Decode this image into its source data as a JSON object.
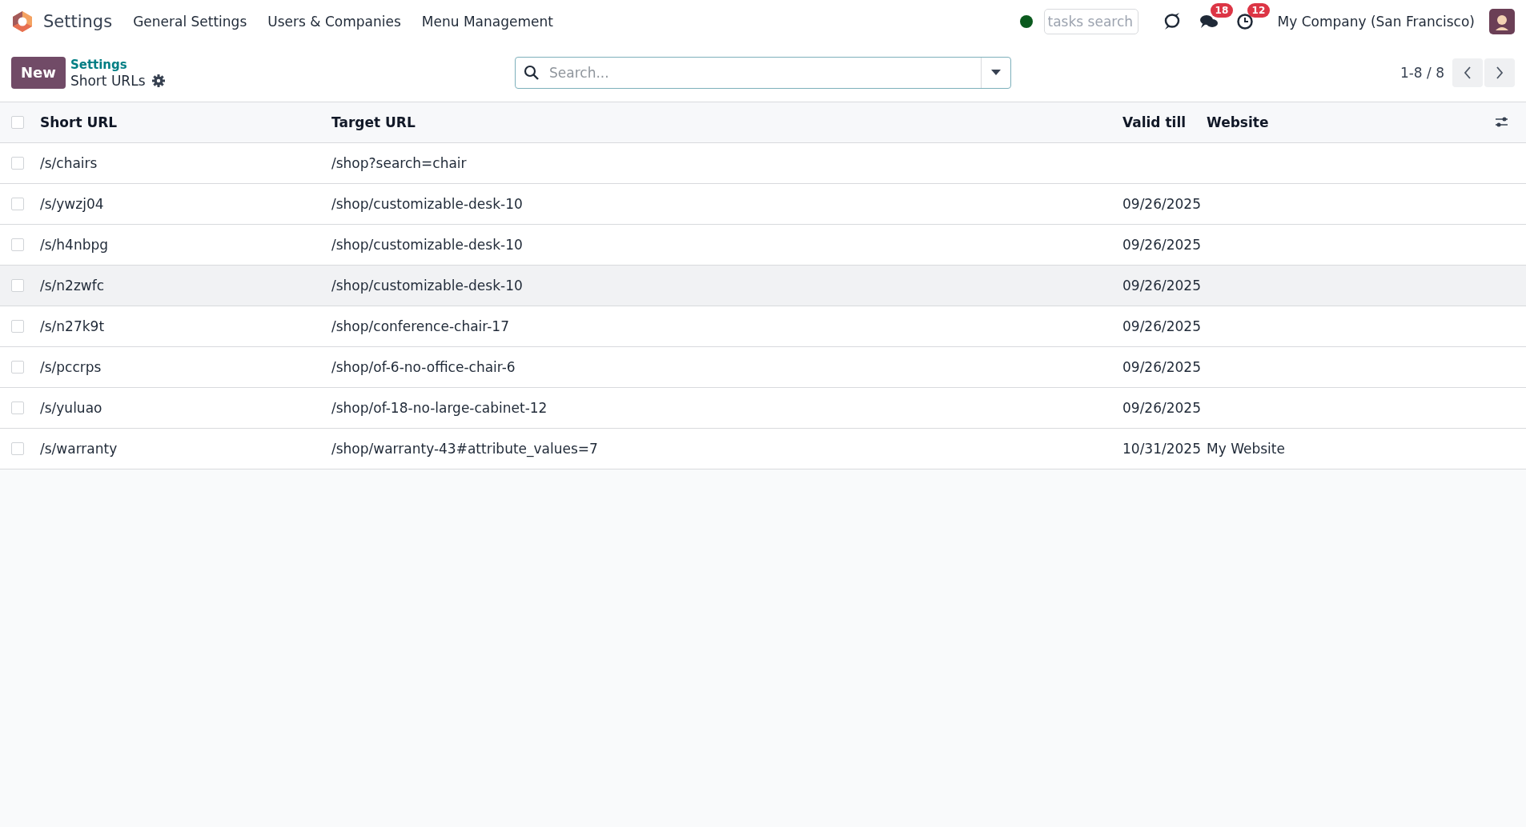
{
  "navbar": {
    "app_name": "Settings",
    "menus": [
      "General Settings",
      "Users & Companies",
      "Menu Management"
    ],
    "search_placeholder": "tasks search",
    "messages_badge": "18",
    "activities_badge": "12",
    "company": "My Company (San Francisco)"
  },
  "control_panel": {
    "new_button": "New",
    "breadcrumb": "Settings",
    "title": "Short URLs",
    "search_placeholder": "Search...",
    "pager": "1-8 / 8"
  },
  "table": {
    "all_checked": false,
    "columns": [
      "Short URL",
      "Target URL",
      "Valid till",
      "Website"
    ],
    "rows": [
      {
        "short_url": "/s/chairs",
        "target_url": "/shop?search=chair",
        "valid_till": "",
        "website": "",
        "highlighted": false,
        "checked": false
      },
      {
        "short_url": "/s/ywzj04",
        "target_url": "/shop/customizable-desk-10",
        "valid_till": "09/26/2025",
        "website": "",
        "highlighted": false,
        "checked": false
      },
      {
        "short_url": "/s/h4nbpg",
        "target_url": "/shop/customizable-desk-10",
        "valid_till": "09/26/2025",
        "website": "",
        "highlighted": false,
        "checked": false
      },
      {
        "short_url": "/s/n2zwfc",
        "target_url": "/shop/customizable-desk-10",
        "valid_till": "09/26/2025",
        "website": "",
        "highlighted": true,
        "checked": false
      },
      {
        "short_url": "/s/n27k9t",
        "target_url": "/shop/conference-chair-17",
        "valid_till": "09/26/2025",
        "website": "",
        "highlighted": false,
        "checked": false
      },
      {
        "short_url": "/s/pccrps",
        "target_url": "/shop/of-6-no-office-chair-6",
        "valid_till": "09/26/2025",
        "website": "",
        "highlighted": false,
        "checked": false
      },
      {
        "short_url": "/s/yuluao",
        "target_url": "/shop/of-18-no-large-cabinet-12",
        "valid_till": "09/26/2025",
        "website": "",
        "highlighted": false,
        "checked": false
      },
      {
        "short_url": "/s/warranty",
        "target_url": "/shop/warranty-43#attribute_values=7",
        "valid_till": "10/31/2025",
        "website": "My Website",
        "highlighted": false,
        "checked": false
      }
    ]
  }
}
